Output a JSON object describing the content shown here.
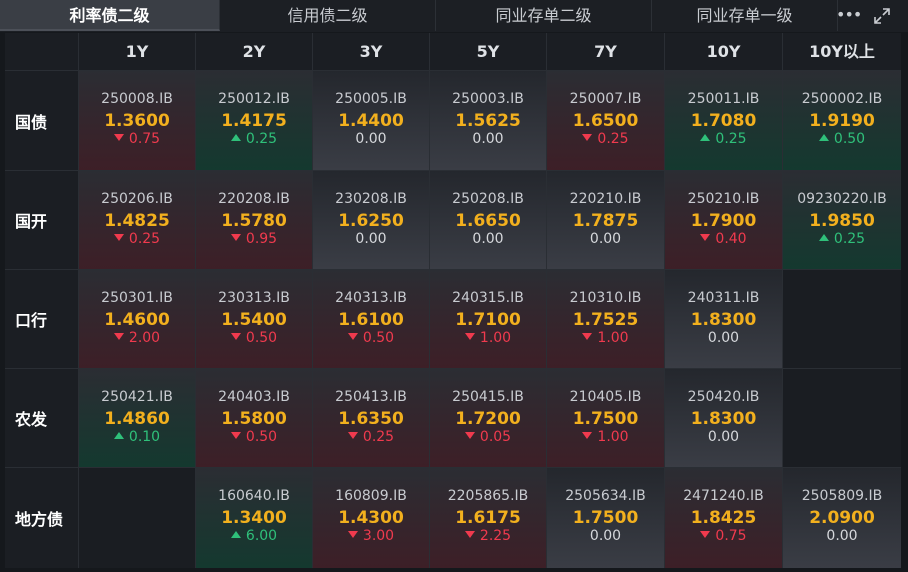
{
  "tabs": [
    {
      "label": "利率债二级",
      "active": true
    },
    {
      "label": "信用债二级",
      "active": false
    },
    {
      "label": "同业存单二级",
      "active": false
    },
    {
      "label": "同业存单一级",
      "active": false
    }
  ],
  "more_icon": "ellipsis-icon",
  "expand_icon": "expand-icon",
  "colors": {
    "rate": "#f2b01e",
    "down": "#f03a4e",
    "up": "#2fc07a",
    "flat": "#d6d8dc"
  },
  "columns": [
    "1Y",
    "2Y",
    "3Y",
    "5Y",
    "7Y",
    "10Y",
    "10Y以上"
  ],
  "rows": [
    {
      "label": "国债",
      "cells": [
        {
          "code": "250008.IB",
          "rate": "1.3600",
          "change": "0.75",
          "dir": "down"
        },
        {
          "code": "250012.IB",
          "rate": "1.4175",
          "change": "0.25",
          "dir": "up"
        },
        {
          "code": "250005.IB",
          "rate": "1.4400",
          "change": "0.00",
          "dir": "flat"
        },
        {
          "code": "250003.IB",
          "rate": "1.5625",
          "change": "0.00",
          "dir": "flat"
        },
        {
          "code": "250007.IB",
          "rate": "1.6500",
          "change": "0.25",
          "dir": "down"
        },
        {
          "code": "250011.IB",
          "rate": "1.7080",
          "change": "0.25",
          "dir": "up"
        },
        {
          "code": "2500002.IB",
          "rate": "1.9190",
          "change": "0.50",
          "dir": "up"
        }
      ]
    },
    {
      "label": "国开",
      "cells": [
        {
          "code": "250206.IB",
          "rate": "1.4825",
          "change": "0.25",
          "dir": "down"
        },
        {
          "code": "220208.IB",
          "rate": "1.5780",
          "change": "0.95",
          "dir": "down"
        },
        {
          "code": "230208.IB",
          "rate": "1.6250",
          "change": "0.00",
          "dir": "flat"
        },
        {
          "code": "250208.IB",
          "rate": "1.6650",
          "change": "0.00",
          "dir": "flat"
        },
        {
          "code": "220210.IB",
          "rate": "1.7875",
          "change": "0.00",
          "dir": "flat"
        },
        {
          "code": "250210.IB",
          "rate": "1.7900",
          "change": "0.40",
          "dir": "down"
        },
        {
          "code": "09230220.IB",
          "rate": "1.9850",
          "change": "0.25",
          "dir": "up"
        }
      ]
    },
    {
      "label": "口行",
      "cells": [
        {
          "code": "250301.IB",
          "rate": "1.4600",
          "change": "2.00",
          "dir": "down"
        },
        {
          "code": "230313.IB",
          "rate": "1.5400",
          "change": "0.50",
          "dir": "down"
        },
        {
          "code": "240313.IB",
          "rate": "1.6100",
          "change": "0.50",
          "dir": "down"
        },
        {
          "code": "240315.IB",
          "rate": "1.7100",
          "change": "1.00",
          "dir": "down"
        },
        {
          "code": "210310.IB",
          "rate": "1.7525",
          "change": "1.00",
          "dir": "down"
        },
        {
          "code": "240311.IB",
          "rate": "1.8300",
          "change": "0.00",
          "dir": "flat"
        },
        null
      ]
    },
    {
      "label": "农发",
      "cells": [
        {
          "code": "250421.IB",
          "rate": "1.4860",
          "change": "0.10",
          "dir": "up"
        },
        {
          "code": "240403.IB",
          "rate": "1.5800",
          "change": "0.50",
          "dir": "down"
        },
        {
          "code": "250413.IB",
          "rate": "1.6350",
          "change": "0.25",
          "dir": "down"
        },
        {
          "code": "250415.IB",
          "rate": "1.7200",
          "change": "0.05",
          "dir": "down"
        },
        {
          "code": "210405.IB",
          "rate": "1.7500",
          "change": "1.00",
          "dir": "down"
        },
        {
          "code": "250420.IB",
          "rate": "1.8300",
          "change": "0.00",
          "dir": "flat"
        },
        null
      ]
    },
    {
      "label": "地方债",
      "cells": [
        null,
        {
          "code": "160640.IB",
          "rate": "1.3400",
          "change": "6.00",
          "dir": "up"
        },
        {
          "code": "160809.IB",
          "rate": "1.4300",
          "change": "3.00",
          "dir": "down"
        },
        {
          "code": "2205865.IB",
          "rate": "1.6175",
          "change": "2.25",
          "dir": "down"
        },
        {
          "code": "2505634.IB",
          "rate": "1.7500",
          "change": "0.00",
          "dir": "flat"
        },
        {
          "code": "2471240.IB",
          "rate": "1.8425",
          "change": "0.75",
          "dir": "down"
        },
        {
          "code": "2505809.IB",
          "rate": "2.0900",
          "change": "0.00",
          "dir": "flat"
        }
      ]
    }
  ]
}
